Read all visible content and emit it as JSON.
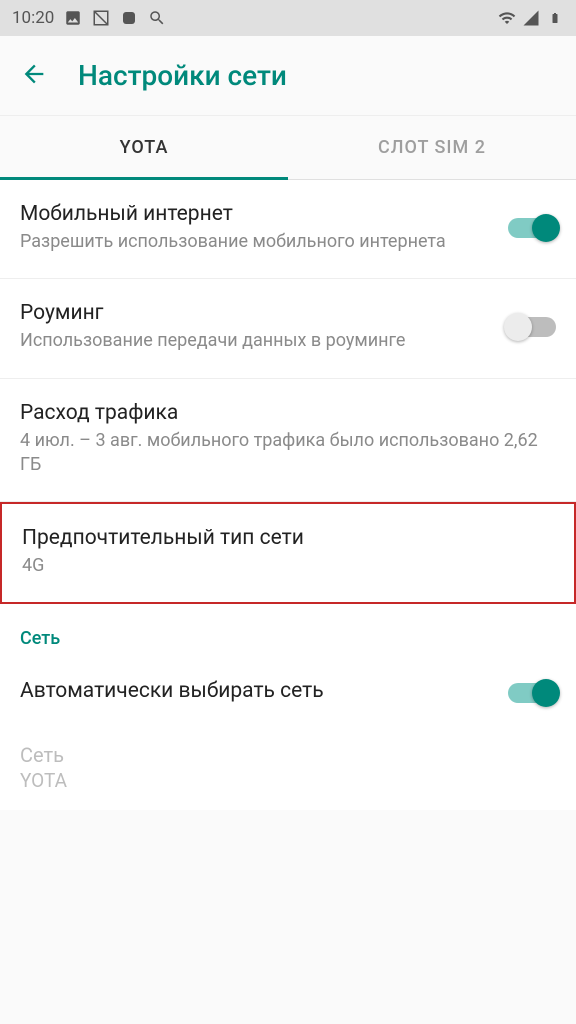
{
  "status": {
    "time": "10:20"
  },
  "header": {
    "title": "Настройки сети"
  },
  "tabs": [
    {
      "label": "YOTA",
      "active": true
    },
    {
      "label": "СЛОТ SIM 2",
      "active": false
    }
  ],
  "settings": {
    "mobile_data": {
      "title": "Мобильный интернет",
      "subtitle": "Разрешить использование мобильного интернета",
      "enabled": true
    },
    "roaming": {
      "title": "Роуминг",
      "subtitle": "Использование передачи данных в роуминге",
      "enabled": false
    },
    "data_usage": {
      "title": "Расход трафика",
      "subtitle": "4 июл. – 3 авг. мобильного трафика было использовано 2,62 ГБ"
    },
    "preferred_network": {
      "title": "Предпочтительный тип сети",
      "subtitle": "4G"
    },
    "section_network": "Сеть",
    "auto_select": {
      "title": "Автоматически выбирать сеть",
      "enabled": true
    },
    "network": {
      "title": "Сеть",
      "subtitle": "YOTA"
    }
  }
}
